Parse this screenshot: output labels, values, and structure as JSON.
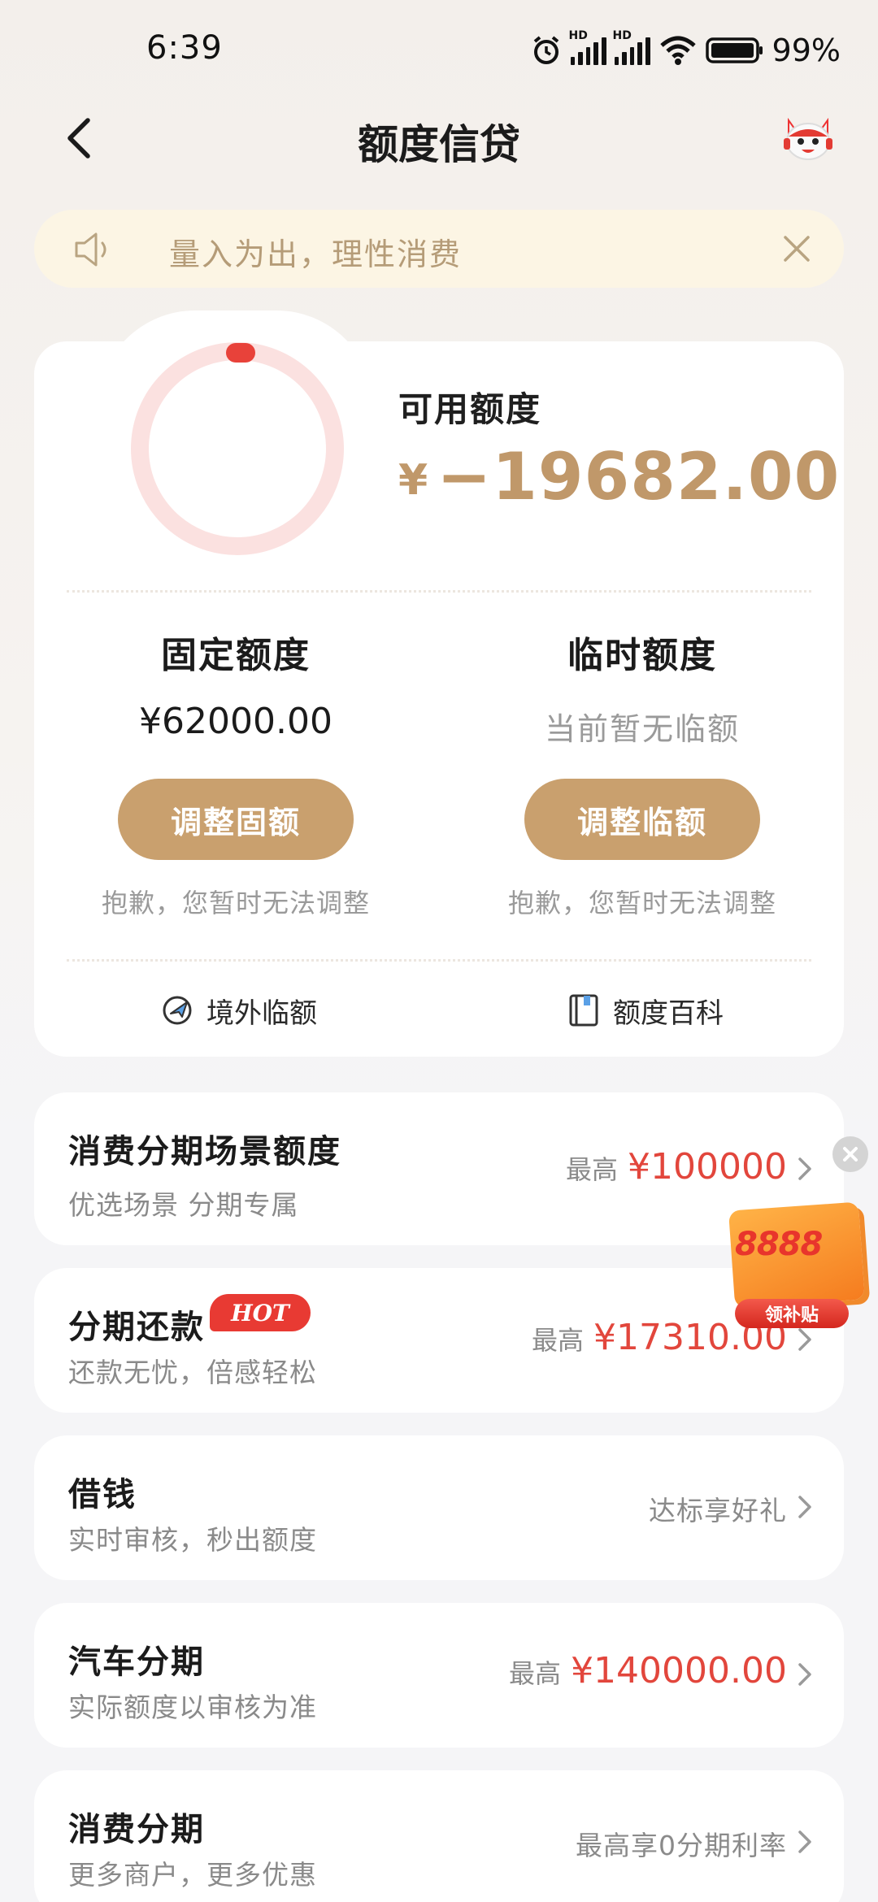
{
  "status_bar": {
    "time": "6:39",
    "network_label": "HD",
    "battery": "99%"
  },
  "nav": {
    "title": "额度信贷"
  },
  "notice": {
    "text": "量入为出，理性消费"
  },
  "credit": {
    "available_label": "可用额度",
    "currency_symbol": "¥",
    "available_amount": "−19682.00",
    "ring_used_fraction": 1.0,
    "fixed": {
      "title": "固定额度",
      "value": "¥62000.00",
      "button": "调整固额",
      "note": "抱歉，您暂时无法调整"
    },
    "temporary": {
      "title": "临时额度",
      "value": "当前暂无临额",
      "button": "调整临额",
      "note": "抱歉，您暂时无法调整"
    },
    "links": {
      "overseas": "境外临额",
      "wiki": "额度百科"
    }
  },
  "items": [
    {
      "title": "消费分期场景额度",
      "subtitle": "优选场景 分期专属",
      "prefix": "最高",
      "value": "¥100000"
    },
    {
      "title": "分期还款",
      "badge": "HOT",
      "subtitle": "还款无忧，倍感轻松",
      "prefix": "最高",
      "value": "¥17310.00"
    },
    {
      "title": "借钱",
      "subtitle": "实时审核，秒出额度",
      "right_text": "达标享好礼"
    },
    {
      "title": "汽车分期",
      "subtitle": "实际额度以审核为准",
      "prefix": "最高",
      "value": "¥140000.00"
    },
    {
      "title": "消费分期",
      "subtitle": "更多商户，更多优惠",
      "right_text": "最高享0分期利率"
    }
  ],
  "promo": {
    "amount": "8888",
    "button": "领补贴"
  },
  "colors": {
    "accent_gold": "#c9a06e",
    "amount_gold": "#c0986a",
    "red": "#e2463c",
    "notice_bg": "#fcf5e4"
  }
}
